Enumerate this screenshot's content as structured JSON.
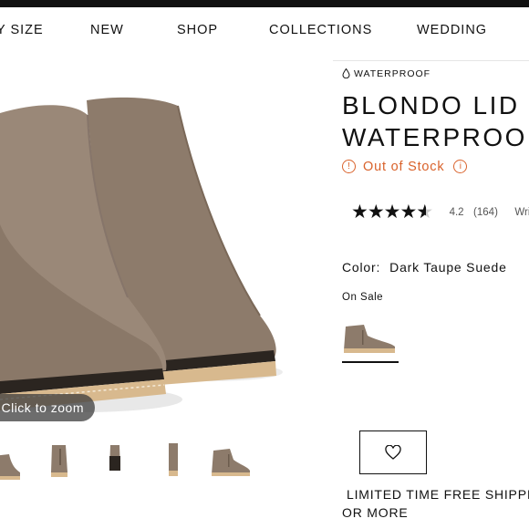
{
  "nav": {
    "items": [
      {
        "label": "Y SIZE"
      },
      {
        "label": "NEW"
      },
      {
        "label": "SHOP"
      },
      {
        "label": "COLLECTIONS"
      },
      {
        "label": "WEDDING"
      }
    ]
  },
  "gallery": {
    "zoom_label": "Click to zoom",
    "thumbnails": [
      "front-pair",
      "side",
      "front",
      "back",
      "outer-side"
    ]
  },
  "product": {
    "badge": "WATERPROOF",
    "title_line1": "BLONDO LID",
    "title_line2": "WATERPROOF",
    "stock_status": "Out of Stock",
    "rating": {
      "value": 4.2,
      "value_text": "4.2",
      "count_text": "(164)",
      "write_text": "Writ"
    },
    "color_label": "Color:",
    "color_value": "Dark Taupe Suede",
    "sale_label": "On Sale",
    "promo_line1": "LIMITED TIME FREE SHIPPING",
    "promo_line2": "OR MORE"
  },
  "colors": {
    "stock_alert": "#d9622b",
    "suede": "#8b7a6a",
    "sole": "#d8b98e"
  },
  "icons": {
    "badge": "droplet-icon",
    "alert": "alert-circle-icon",
    "info": "info-circle-icon",
    "wishlist": "heart-icon"
  }
}
